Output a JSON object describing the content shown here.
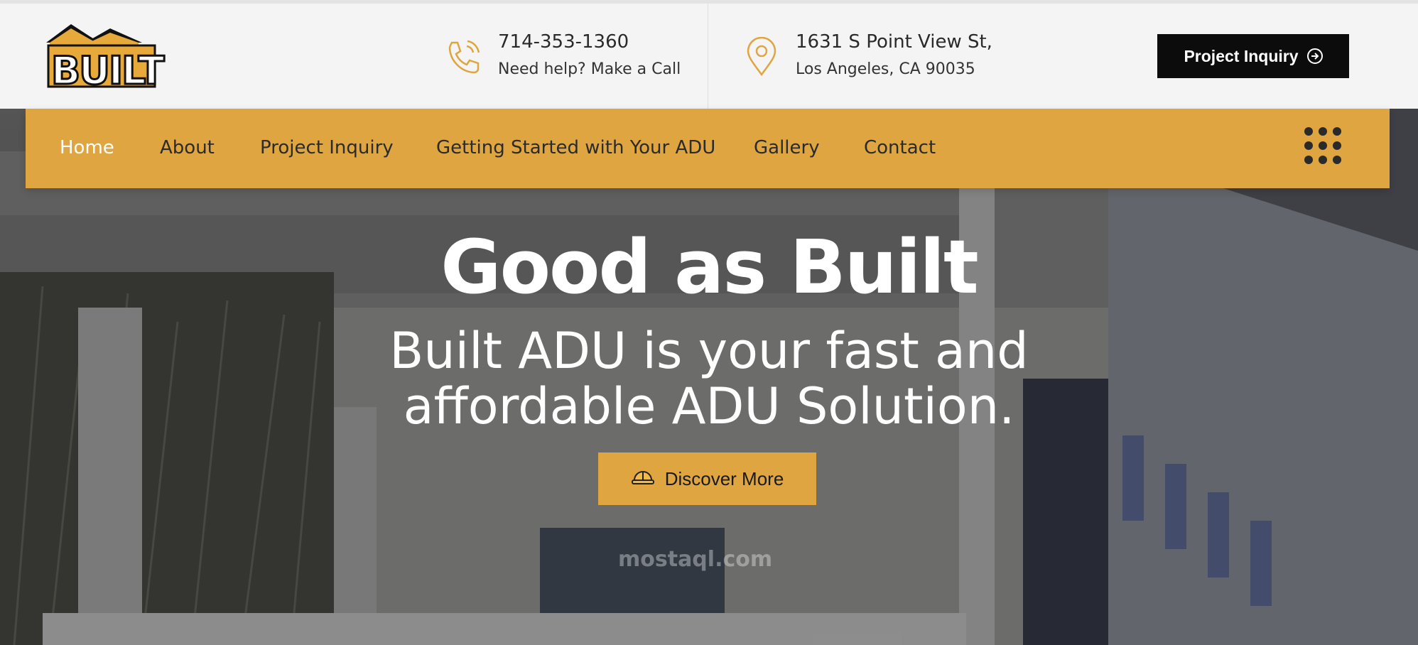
{
  "brand": {
    "logo_text": "BUILT",
    "accent": "#dfa541",
    "dark": "#0c0c0c"
  },
  "header": {
    "phone": {
      "icon": "phone-icon",
      "number": "714-353-1360",
      "caption": "Need help? Make a Call"
    },
    "address": {
      "icon": "map-pin-icon",
      "line1": "1631 S Point View St,",
      "line2": "Los Angeles, CA 90035"
    },
    "cta_label": "Project Inquiry"
  },
  "nav": {
    "items": [
      {
        "label": "Home",
        "active": true
      },
      {
        "label": "About"
      },
      {
        "label": "Project Inquiry"
      },
      {
        "label": "Getting Started with Your ADU"
      },
      {
        "label": "Gallery"
      },
      {
        "label": "Contact"
      }
    ],
    "menu_icon": "grid-dots-icon"
  },
  "hero": {
    "title": "Good as Built",
    "subtitle_line1": "Built ADU is your fast and",
    "subtitle_line2": "affordable ADU Solution.",
    "button_label": "Discover More",
    "button_icon": "hard-hat-icon"
  },
  "watermark": "mostaql.com"
}
